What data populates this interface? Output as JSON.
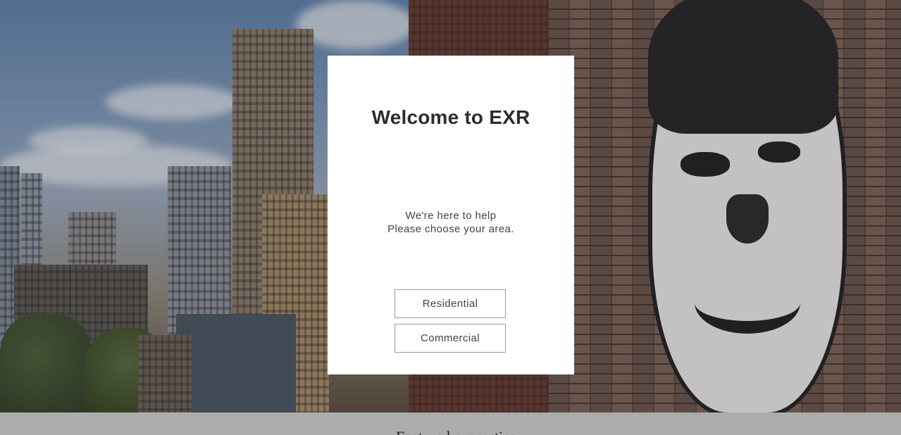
{
  "modal": {
    "title": "Welcome to EXR",
    "message_line1": "We're here to help",
    "message_line2": "Please choose your area.",
    "buttons": [
      {
        "label": "Residential"
      },
      {
        "label": "Commercial"
      }
    ]
  },
  "footer": {
    "partial_heading": "Featured properties"
  },
  "colors": {
    "modal_bg": "#ffffff",
    "title": "#2d2d2d",
    "button_border": "#9b9b9b",
    "footer_strip": "#acacac"
  }
}
